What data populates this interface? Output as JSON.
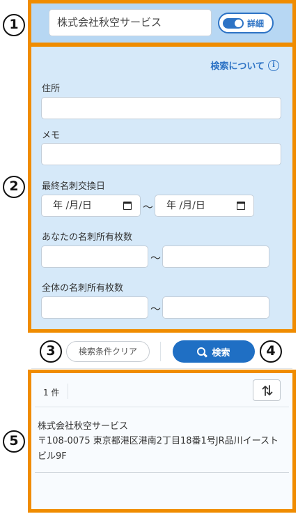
{
  "markers": [
    "1",
    "2",
    "3",
    "4",
    "5"
  ],
  "header": {
    "company_value": "株式会社秋空サービス",
    "detail_toggle_label": "詳細",
    "detail_toggle_on": true
  },
  "search": {
    "about_link": "検索について",
    "address_label": "住所",
    "address_value": "",
    "memo_label": "メモ",
    "memo_value": "",
    "last_exchange_label": "最終名刺交換日",
    "date_from_placeholder": "年 /月/日",
    "date_to_placeholder": "年 /月/日",
    "range_separator": "〜",
    "your_cards_label": "あなたの名刺所有枚数",
    "all_cards_label": "全体の名刺所有枚数"
  },
  "actions": {
    "clear_label": "検索条件クリア",
    "search_label": "検索"
  },
  "results": {
    "count_text": "1 件",
    "items": [
      {
        "name": "株式会社秋空サービス",
        "address": "〒108-0075 東京都港区港南2丁目18番1号JR品川イーストビル9F"
      }
    ]
  },
  "colors": {
    "marker_frame": "#f08c00",
    "header_bg": "#b7d7f3",
    "panel_bg": "#d6e9f9",
    "accent": "#1f6fc4"
  }
}
